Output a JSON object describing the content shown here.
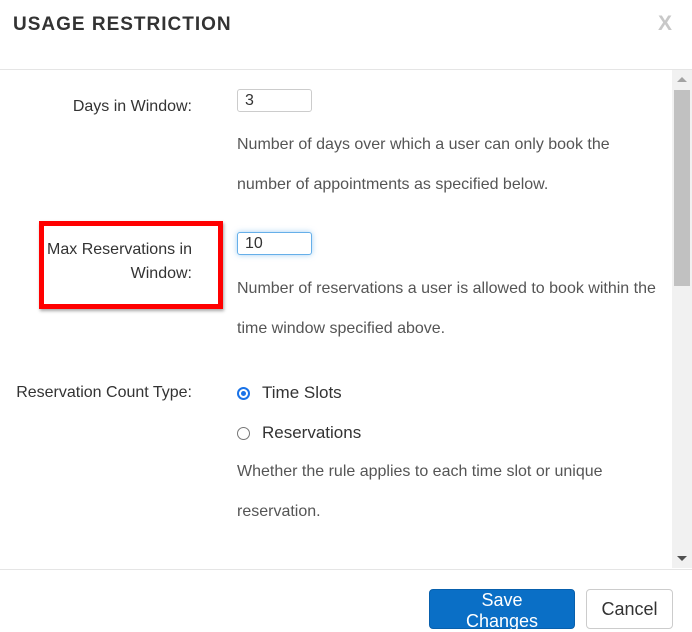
{
  "dialog": {
    "title": "USAGE RESTRICTION",
    "close_label": "X"
  },
  "fields": {
    "days_in_window": {
      "label": "Days in Window:",
      "value": "3",
      "help": "Number of days over which a user can only book the number of appointments as specified below."
    },
    "max_reservations": {
      "label_line1": "Max Reservations in",
      "label_line2": "Window:",
      "value": "10",
      "help": "Number of reservations a user is allowed to book within the time window specified above."
    },
    "count_type": {
      "label": "Reservation Count Type:",
      "options": [
        {
          "label": "Time Slots",
          "selected": true
        },
        {
          "label": "Reservations",
          "selected": false
        }
      ],
      "help": "Whether the rule applies to each time slot or unique reservation."
    }
  },
  "footer": {
    "save_label": "Save Changes",
    "cancel_label": "Cancel"
  },
  "colors": {
    "accent": "#0a6fc6",
    "highlight_box": "#ff0000"
  }
}
